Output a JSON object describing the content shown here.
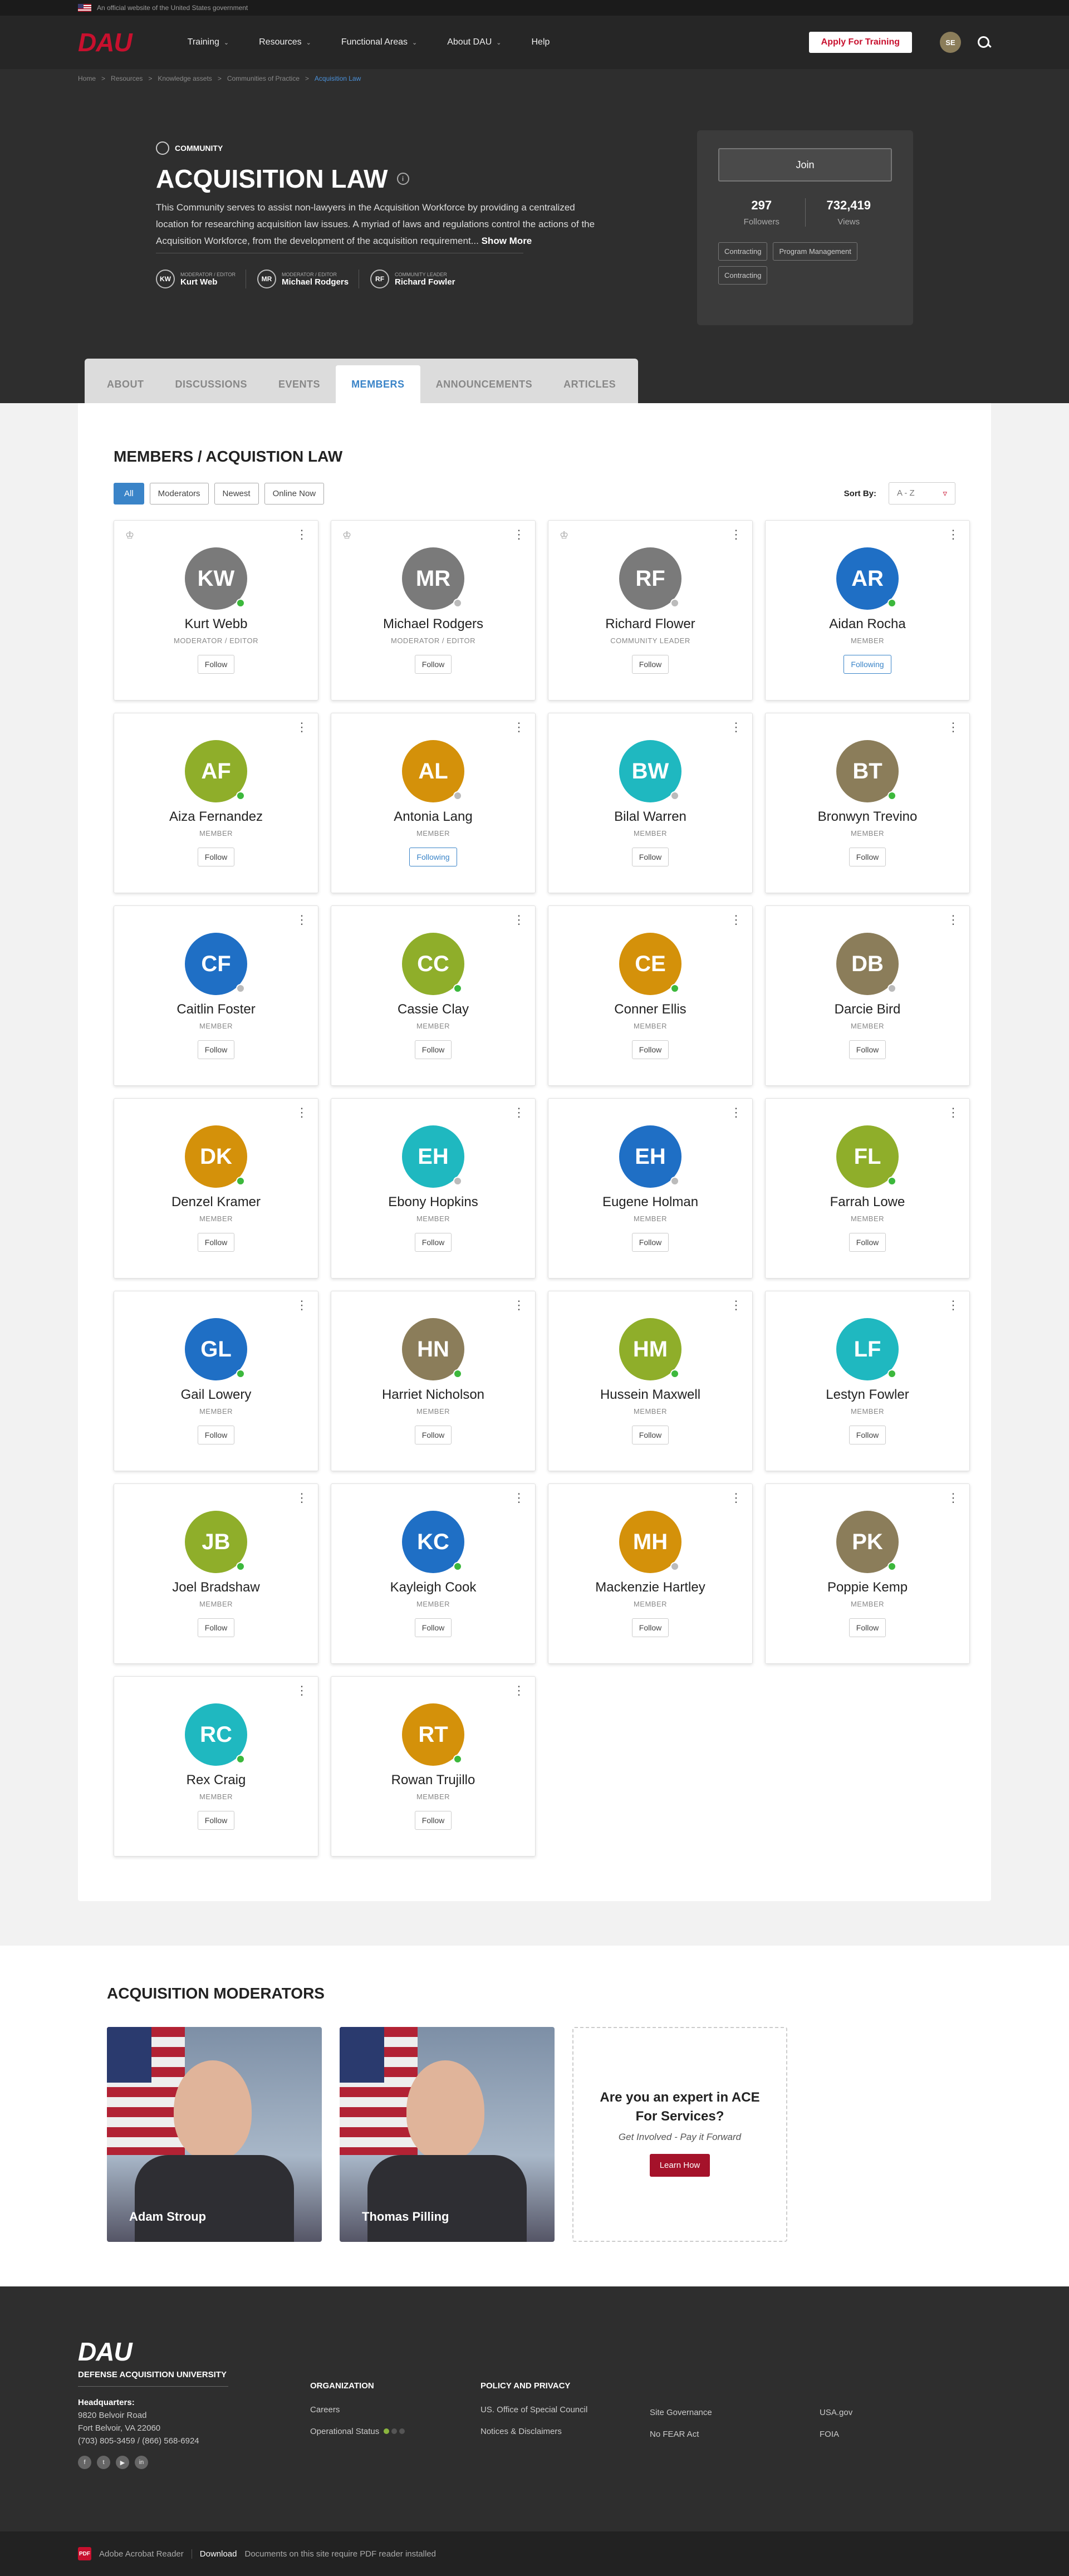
{
  "banner": {
    "text": "An official website of the United States government"
  },
  "nav": {
    "logo": "DAU",
    "items": [
      "Training",
      "Resources",
      "Functional Areas",
      "About DAU",
      "Help"
    ],
    "apply": "Apply For Training",
    "user_initials": "SE"
  },
  "breadcrumb": [
    "Home",
    "Resources",
    "Knowledge assets",
    "Communities of Practice",
    "Acquisition Law"
  ],
  "hero": {
    "tag": "COMMUNITY",
    "title": "ACQUISITION LAW",
    "info": "i",
    "description": "This Community serves to assist non-lawyers in the Acquisition Workforce by providing a centralized location for researching acquisition law issues. A myriad of laws and regulations control the actions of the Acquisition Workforce, from the development of the acquisition requirement...",
    "show_more": "Show More",
    "leaders": [
      {
        "initials": "KW",
        "role": "MODERATOR / EDITOR",
        "name": "Kurt Web"
      },
      {
        "initials": "MR",
        "role": "MODERATOR / EDITOR",
        "name": "Michael Rodgers"
      },
      {
        "initials": "RF",
        "role": "COMMUNITY LEADER",
        "name": "Richard Fowler"
      }
    ],
    "join": "Join",
    "followers": "297",
    "followers_label": "Followers",
    "views": "732,419",
    "views_label": "Views",
    "chips": [
      "Contracting",
      "Program Management",
      "Contracting"
    ]
  },
  "tabs": [
    "ABOUT",
    "DISCUSSIONS",
    "EVENTS",
    "MEMBERS",
    "ANNOUNCEMENTS",
    "ARTICLES"
  ],
  "members": {
    "title": "MEMBERS / ACQUISTION LAW",
    "filters": [
      "All",
      "Moderators",
      "Newest",
      "Online Now"
    ],
    "sort_label": "Sort By:",
    "sort_value": "A - Z",
    "list": [
      {
        "initials": "KW",
        "name": "Kurt Webb",
        "role": "MODERATOR / EDITOR",
        "color": "#7a7a7a",
        "status": "online",
        "follow": "Follow",
        "crown": true
      },
      {
        "initials": "MR",
        "name": "Michael Rodgers",
        "role": "MODERATOR / EDITOR",
        "color": "#7a7a7a",
        "status": "offline",
        "follow": "Follow",
        "crown": true
      },
      {
        "initials": "RF",
        "name": "Richard Flower",
        "role": "COMMUNITY LEADER",
        "color": "#7a7a7a",
        "status": "offline",
        "follow": "Follow",
        "crown": true
      },
      {
        "initials": "AR",
        "name": "Aidan Rocha",
        "role": "MEMBER",
        "color": "#1f6fc5",
        "status": "online",
        "follow": "Following",
        "crown": false
      },
      {
        "initials": "AF",
        "name": "Aiza Fernandez",
        "role": "MEMBER",
        "color": "#8fae2a",
        "status": "online",
        "follow": "Follow",
        "crown": false
      },
      {
        "initials": "AL",
        "name": "Antonia Lang",
        "role": "MEMBER",
        "color": "#d4910a",
        "status": "offline",
        "follow": "Following",
        "crown": false
      },
      {
        "initials": "BW",
        "name": "Bilal Warren",
        "role": "MEMBER",
        "color": "#1fb8c0",
        "status": "offline",
        "follow": "Follow",
        "crown": false
      },
      {
        "initials": "BT",
        "name": "Bronwyn Trevino",
        "role": "MEMBER",
        "color": "#8b7d5a",
        "status": "online",
        "follow": "Follow",
        "crown": false
      },
      {
        "initials": "CF",
        "name": "Caitlin Foster",
        "role": "MEMBER",
        "color": "#1f6fc5",
        "status": "offline",
        "follow": "Follow",
        "crown": false
      },
      {
        "initials": "CC",
        "name": "Cassie Clay",
        "role": "MEMBER",
        "color": "#8fae2a",
        "status": "online",
        "follow": "Follow",
        "crown": false
      },
      {
        "initials": "CE",
        "name": "Conner Ellis",
        "role": "MEMBER",
        "color": "#d4910a",
        "status": "online",
        "follow": "Follow",
        "crown": false
      },
      {
        "initials": "DB",
        "name": "Darcie Bird",
        "role": "MEMBER",
        "color": "#8b7d5a",
        "status": "offline",
        "follow": "Follow",
        "crown": false
      },
      {
        "initials": "DK",
        "name": "Denzel Kramer",
        "role": "MEMBER",
        "color": "#d4910a",
        "status": "online",
        "follow": "Follow",
        "crown": false
      },
      {
        "initials": "EH",
        "name": "Ebony Hopkins",
        "role": "MEMBER",
        "color": "#1fb8c0",
        "status": "offline",
        "follow": "Follow",
        "crown": false
      },
      {
        "initials": "EH",
        "name": "Eugene Holman",
        "role": "MEMBER",
        "color": "#1f6fc5",
        "status": "offline",
        "follow": "Follow",
        "crown": false
      },
      {
        "initials": "FL",
        "name": "Farrah Lowe",
        "role": "MEMBER",
        "color": "#8fae2a",
        "status": "online",
        "follow": "Follow",
        "crown": false
      },
      {
        "initials": "GL",
        "name": "Gail Lowery",
        "role": "MEMBER",
        "color": "#1f6fc5",
        "status": "online",
        "follow": "Follow",
        "crown": false
      },
      {
        "initials": "HN",
        "name": "Harriet Nicholson",
        "role": "MEMBER",
        "color": "#8b7d5a",
        "status": "online",
        "follow": "Follow",
        "crown": false
      },
      {
        "initials": "HM",
        "name": "Hussein Maxwell",
        "role": "MEMBER",
        "color": "#8fae2a",
        "status": "online",
        "follow": "Follow",
        "crown": false
      },
      {
        "initials": "LF",
        "name": "Lestyn Fowler",
        "role": "MEMBER",
        "color": "#1fb8c0",
        "status": "online",
        "follow": "Follow",
        "crown": false
      },
      {
        "initials": "JB",
        "name": "Joel Bradshaw",
        "role": "MEMBER",
        "color": "#8fae2a",
        "status": "online",
        "follow": "Follow",
        "crown": false
      },
      {
        "initials": "KC",
        "name": "Kayleigh Cook",
        "role": "MEMBER",
        "color": "#1f6fc5",
        "status": "online",
        "follow": "Follow",
        "crown": false
      },
      {
        "initials": "MH",
        "name": "Mackenzie Hartley",
        "role": "MEMBER",
        "color": "#d4910a",
        "status": "offline",
        "follow": "Follow",
        "crown": false
      },
      {
        "initials": "PK",
        "name": "Poppie Kemp",
        "role": "MEMBER",
        "color": "#8b7d5a",
        "status": "online",
        "follow": "Follow",
        "crown": false
      },
      {
        "initials": "RC",
        "name": "Rex Craig",
        "role": "MEMBER",
        "color": "#1fb8c0",
        "status": "online",
        "follow": "Follow",
        "crown": false
      },
      {
        "initials": "RT",
        "name": "Rowan Trujillo",
        "role": "MEMBER",
        "color": "#d4910a",
        "status": "online",
        "follow": "Follow",
        "crown": false
      }
    ]
  },
  "moderators": {
    "title": "ACQUISITION MODERATORS",
    "people": [
      "Adam Stroup",
      "Thomas Pilling"
    ],
    "expert_title": "Are you an expert in ACE For Services?",
    "expert_sub": "Get Involved - Pay it Forward",
    "learn": "Learn How"
  },
  "footer": {
    "logo": "DAU",
    "org": "DEFENSE ACQUISITION UNIVERSITY",
    "hq_label": "Headquarters:",
    "addr1": "9820 Belvoir Road",
    "addr2": "Fort Belvoir, VA 22060",
    "phone": "(703) 805-3459 / (866) 568-6924",
    "org_title": "ORGANIZATION",
    "careers": "Careers",
    "op_status": "Operational Status",
    "policy_title": "POLICY AND PRIVACY",
    "links": [
      "US. Office of Special Council",
      "Notices & Disclaimers",
      "Site Governance",
      "No FEAR Act",
      "USA.gov",
      "FOIA"
    ]
  },
  "bottom": {
    "reader": "Adobe Acrobat Reader",
    "download": "Download",
    "note": "Documents on this site require PDF reader installed"
  }
}
